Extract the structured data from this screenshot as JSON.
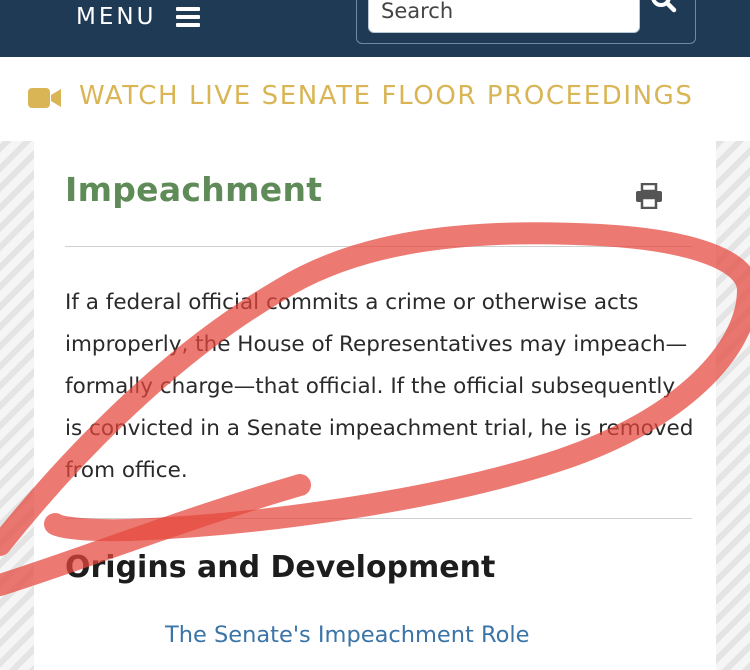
{
  "header": {
    "menu_label": "MENU",
    "search_placeholder": "Search"
  },
  "live_banner": {
    "text": "WATCH LIVE SENATE FLOOR PROCEEDINGS",
    "accent_color": "#d9b555"
  },
  "article": {
    "title": "Impeachment",
    "intro": "If a federal official commits a crime or otherwise acts improperly, the House of Representatives may impeach—formally charge—that official. If the official subsequently is convicted in a Senate impeachment trial, he is removed from office.",
    "section_heading": "Origins and Development",
    "links": [
      "The Senate's Impeachment Role"
    ]
  },
  "colors": {
    "nav_bg": "#1f3a55",
    "title": "#5f8b58",
    "link": "#3b74a7",
    "marker": "#e4463c"
  },
  "icons": [
    "hamburger-icon",
    "search-icon",
    "video-camera-icon",
    "print-icon"
  ]
}
